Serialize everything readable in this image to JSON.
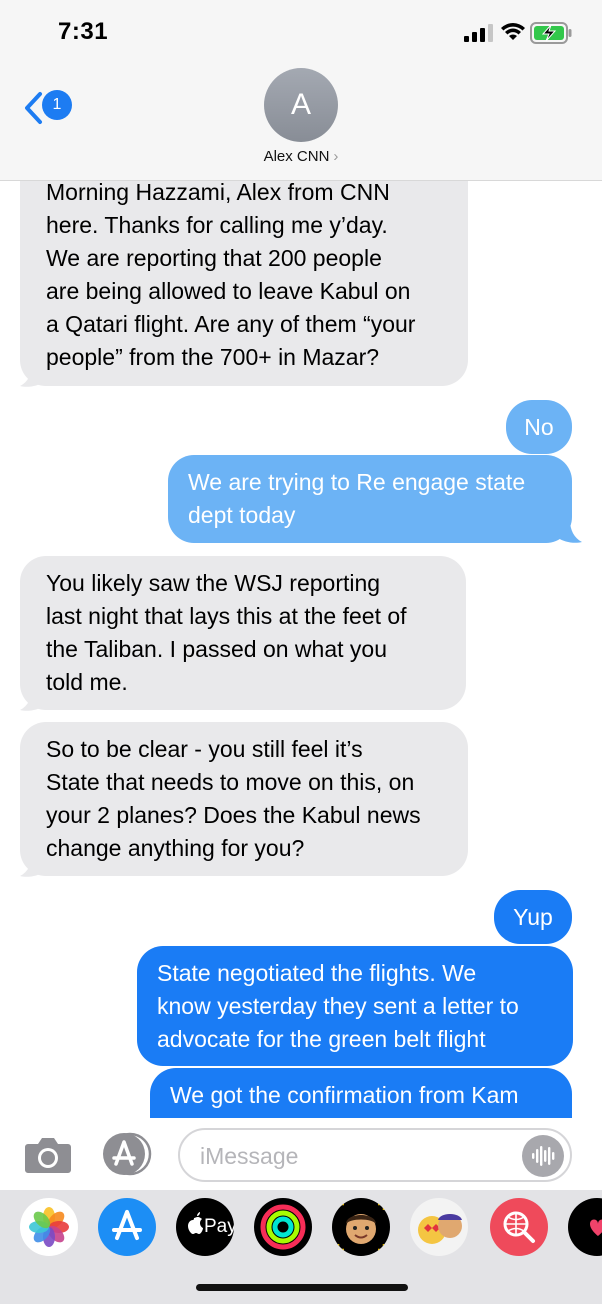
{
  "status_bar": {
    "time": "7:31"
  },
  "header": {
    "back_badge": "1",
    "avatar_initial": "A",
    "contact_name": "Alex CNN"
  },
  "messages": [
    {
      "text": "Morning Hazzami, Alex from CNN here. Thanks for calling me y’day. We are reporting that 200 people are being allowed to leave Kabul on a Qatari flight. Are any of them “your people” from the 700+ in Mazar?",
      "lines": [
        "Morning Hazzami, Alex from CNN",
        "here. Thanks for calling me y’day.",
        "We are reporting that 200 people",
        "are being allowed to leave Kabul on",
        "a Qatari flight. Are any of them “your",
        "people” from the 700+ in Mazar?"
      ],
      "direction": "incoming"
    },
    {
      "lines": [
        "No"
      ],
      "direction": "outgoing"
    },
    {
      "lines": [
        "We are trying to Re engage state",
        "dept today"
      ],
      "direction": "outgoing"
    },
    {
      "lines": [
        "You likely saw the WSJ reporting",
        "last night that lays this at the feet of",
        "the Taliban. I passed on what you",
        "told me."
      ],
      "direction": "incoming"
    },
    {
      "lines": [
        "So to be clear - you still feel it’s",
        "State that needs to move on this, on",
        "your 2 planes? Does the Kabul news",
        "change anything for you?"
      ],
      "direction": "incoming"
    },
    {
      "lines": [
        "Yup"
      ],
      "direction": "outgoing"
    },
    {
      "lines": [
        "State negotiated the flights. We",
        "know yesterday they sent a letter to",
        "advocate for the green belt flight"
      ],
      "direction": "outgoing"
    },
    {
      "lines": [
        "We got the confirmation from Kam"
      ],
      "direction": "outgoing"
    }
  ],
  "input_bar": {
    "placeholder": "iMessage"
  },
  "app_drawer": {
    "items": [
      "photos-icon",
      "app-store-icon",
      "apple-pay-icon",
      "fitness-icon",
      "memoji-icon",
      "memoji-stickers-icon",
      "web-search-icon",
      "digital-touch-icon"
    ],
    "apple_pay_label": "Pay"
  },
  "colors": {
    "incoming_bubble": "#e9e9eb",
    "outgoing_bubble": "#1a7cf5",
    "outgoing_bubble_sending": "#6cb3f5",
    "accent": "#1d7cf2"
  }
}
